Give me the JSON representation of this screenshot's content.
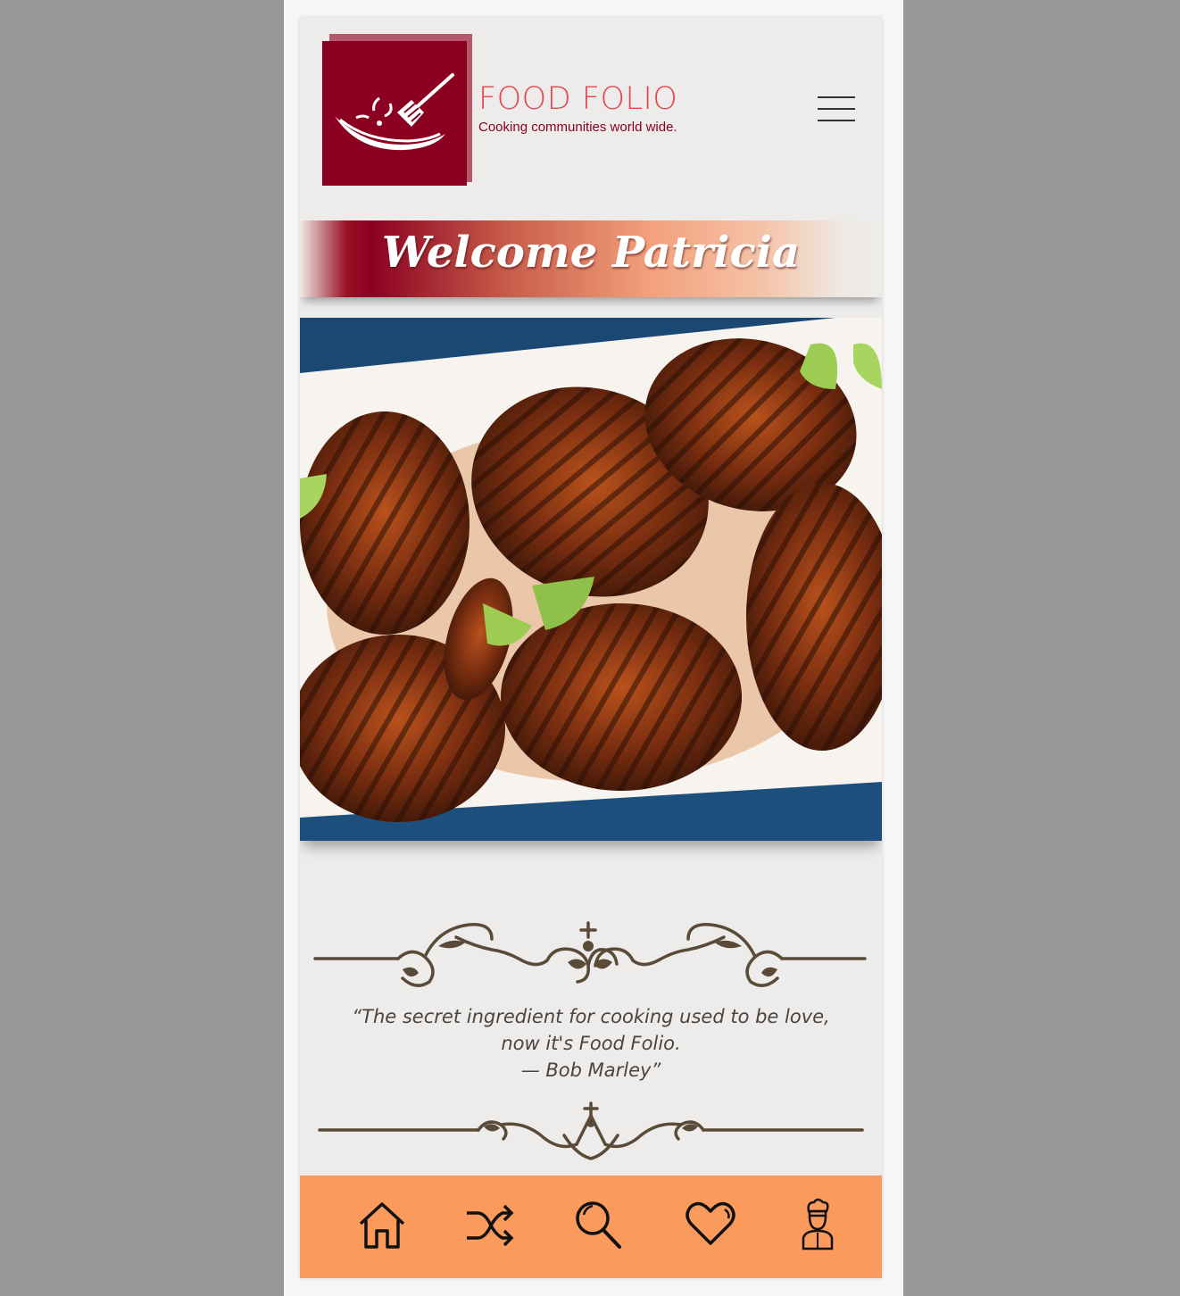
{
  "brand": {
    "name": "FOOD FOLIO",
    "tagline": "Cooking communities world wide."
  },
  "welcome": {
    "text": "Welcome Patricia"
  },
  "quote": {
    "line1": "“The secret ingredient for cooking used to be love,",
    "line2": "now it's Food Folio.",
    "line3": "— Bob Marley”"
  },
  "nav": {
    "items": [
      {
        "icon": "home-icon"
      },
      {
        "icon": "shuffle-icon"
      },
      {
        "icon": "search-icon"
      },
      {
        "icon": "heart-icon"
      },
      {
        "icon": "chef-icon"
      }
    ]
  },
  "colors": {
    "brand": "#8b0021",
    "accent": "#e4474f",
    "nav_bg": "#fa9a5c",
    "page_bg": "#eeecea"
  }
}
